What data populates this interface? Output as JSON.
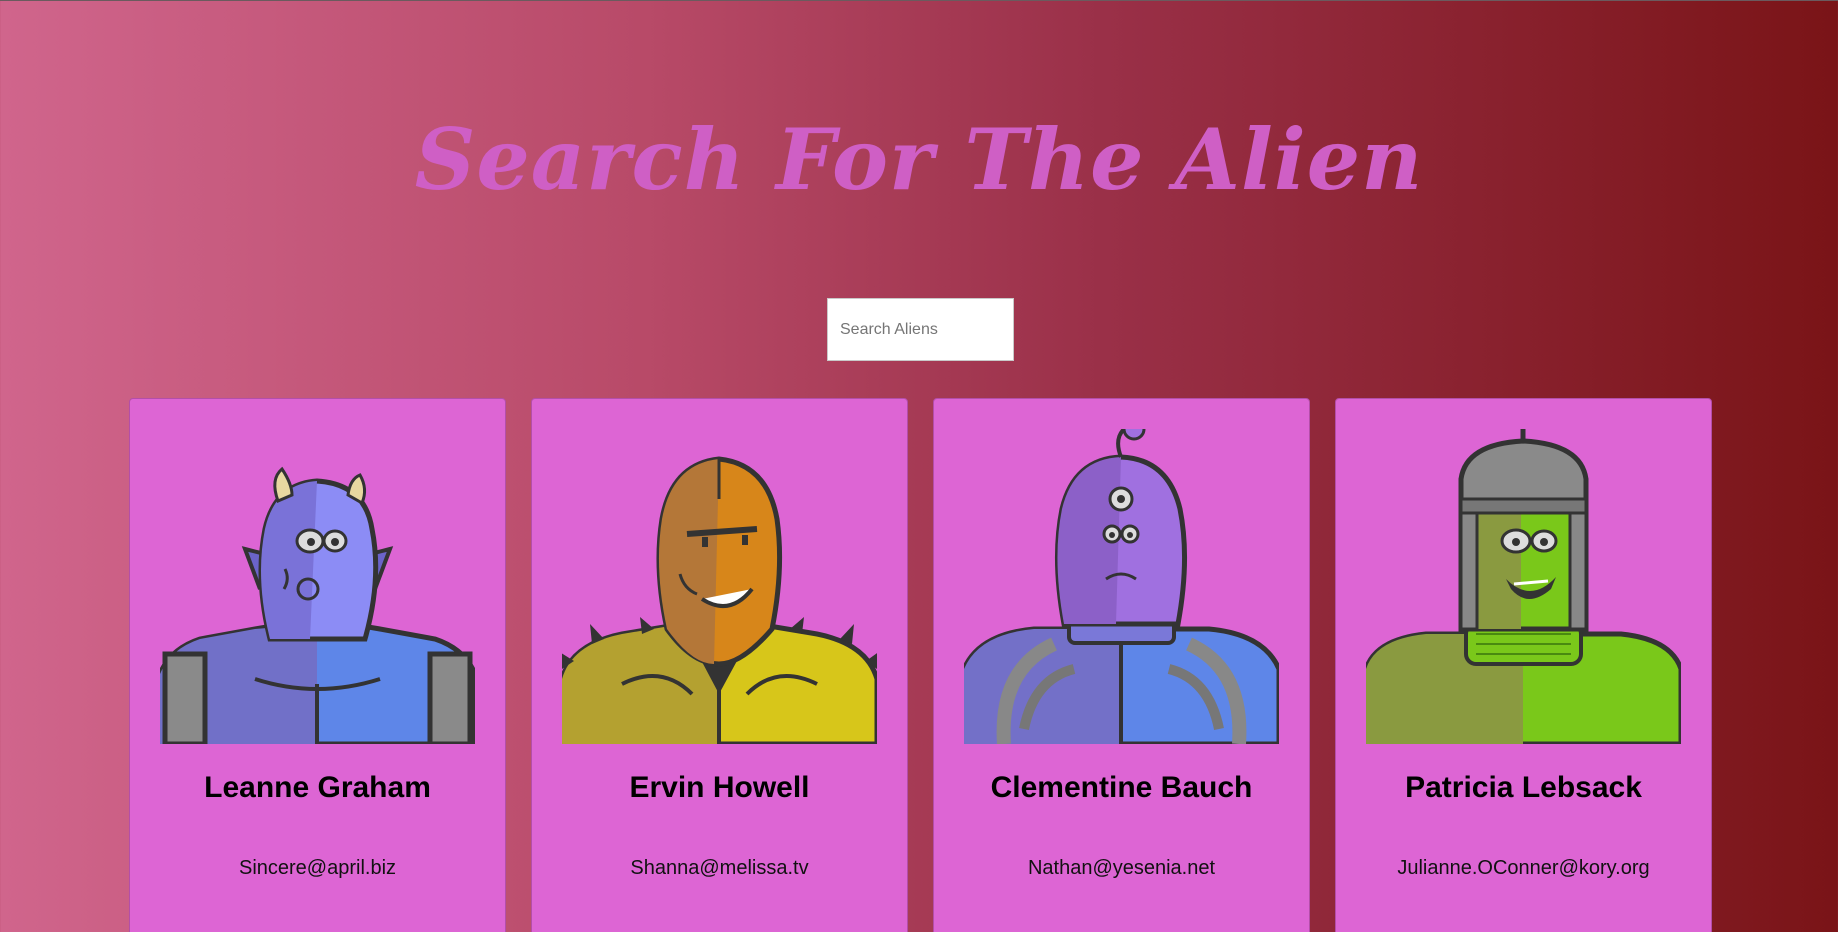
{
  "header": {
    "title": "Search For The Alien"
  },
  "search": {
    "placeholder": "Search Aliens",
    "value": ""
  },
  "colors": {
    "title": "#cf5fc5",
    "card_background": "#dd65d4",
    "gradient_left": "#d0658c",
    "gradient_right": "#7a1417"
  },
  "aliens": [
    {
      "name": "Leanne Graham",
      "email": "Sincere@april.biz",
      "avatar_icon": "blue-horned-alien-avatar"
    },
    {
      "name": "Ervin Howell",
      "email": "Shanna@melissa.tv",
      "avatar_icon": "orange-hooded-alien-avatar"
    },
    {
      "name": "Clementine Bauch",
      "email": "Nathan@yesenia.net",
      "avatar_icon": "purple-three-eyed-alien-avatar"
    },
    {
      "name": "Patricia Lebsack",
      "email": "Julianne.OConner@kory.org",
      "avatar_icon": "green-robot-helmet-alien-avatar"
    }
  ]
}
